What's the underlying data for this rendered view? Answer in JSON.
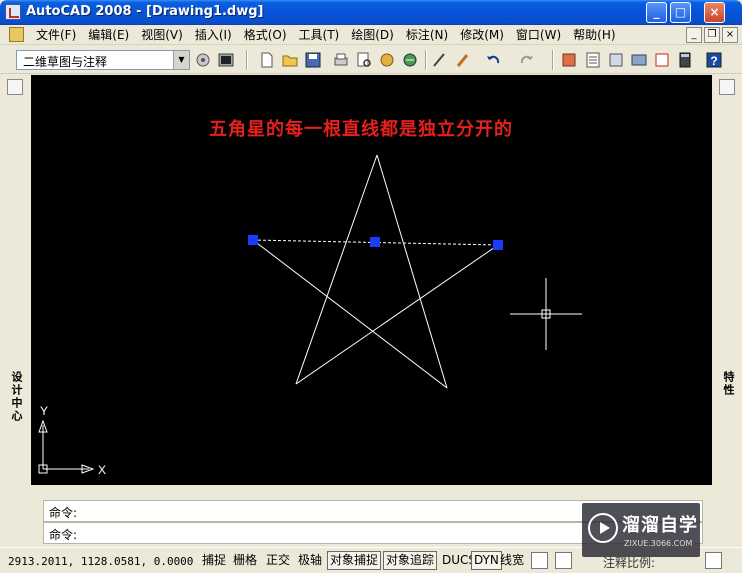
{
  "window": {
    "title": "AutoCAD 2008 - [Drawing1.dwg]"
  },
  "menu": {
    "items": [
      "文件(F)",
      "编辑(E)",
      "视图(V)",
      "插入(I)",
      "格式(O)",
      "工具(T)",
      "绘图(D)",
      "标注(N)",
      "修改(M)",
      "窗口(W)",
      "帮助(H)"
    ]
  },
  "toolbar": {
    "workspace": "二维草图与注释",
    "icons": [
      "workspace-settings-icon",
      "workspace-icon",
      "new-file-icon",
      "open-file-icon",
      "save-icon",
      "plot-icon",
      "plot-preview-icon",
      "publish-icon",
      "3d-dwf-icon",
      "cut-icon",
      "match-properties-icon",
      "undo-icon",
      "redo-icon",
      "pan-icon",
      "properties-icon",
      "design-center-icon",
      "tool-palettes-icon",
      "sheet-set-icon",
      "markup-icon",
      "calculator-icon",
      "help-icon"
    ]
  },
  "left_panel": {
    "label": "设计中心"
  },
  "right_panel": {
    "label": "特性"
  },
  "canvas": {
    "background": "#000000",
    "annotation": "五角星的每一根直线都是独立分开的",
    "annotation_color": "#e5201d",
    "ucs_x_label": "X",
    "ucs_y_label": "Y",
    "grip_color": "#1a3cff",
    "selected_line": "dashed"
  },
  "command": {
    "line1": "命令:",
    "line2": "命令:"
  },
  "status": {
    "coordinates": "2913.2011, 1128.0581, 0.0000",
    "buttons": [
      {
        "label": "捕捉",
        "on": false
      },
      {
        "label": "栅格",
        "on": false
      },
      {
        "label": "正交",
        "on": false
      },
      {
        "label": "极轴",
        "on": false
      },
      {
        "label": "对象捕捉",
        "on": true
      },
      {
        "label": "对象追踪",
        "on": true
      },
      {
        "label": "DUCS",
        "on": false
      },
      {
        "label": "DYN",
        "on": true
      },
      {
        "label": "线宽",
        "on": false
      }
    ],
    "scale_label": "注释比例:"
  },
  "watermark": {
    "name": "溜溜自学",
    "url": "ZIXUE.3066.COM"
  }
}
